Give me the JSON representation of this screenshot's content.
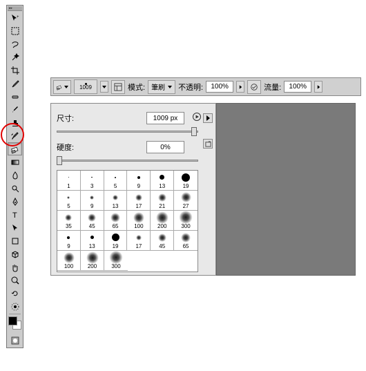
{
  "toolbox": {
    "tools": [
      "move-tool",
      "marquee-tool",
      "lasso-tool",
      "magic-wand-tool",
      "crop-tool",
      "eyedropper-tool",
      "healing-tool",
      "brush-tool",
      "stamp-tool",
      "history-brush-tool",
      "eraser-tool",
      "gradient-tool",
      "blur-tool",
      "dodge-tool",
      "pen-tool",
      "type-tool",
      "path-select-tool",
      "shape-tool",
      "3d-tool",
      "hand-tool",
      "zoom-tool",
      "rotate-tool",
      "artboard-tool"
    ],
    "selected": "eraser-tool"
  },
  "options": {
    "brush_size_display": "1009",
    "mode_label": "模式:",
    "mode_value": "筆刷",
    "opacity_label": "不透明:",
    "opacity_value": "100%",
    "flow_label": "流量:",
    "flow_value": "100%"
  },
  "brush_panel": {
    "size_label": "尺寸:",
    "size_value": "1009 px",
    "hardness_label": "硬度:",
    "hardness_value": "0%",
    "size_slider_pos": 100,
    "hardness_slider_pos": 0,
    "grid": [
      [
        {
          "s": 1,
          "d": 1,
          "soft": false
        },
        {
          "s": 3,
          "d": 1.5,
          "soft": false
        },
        {
          "s": 5,
          "d": 2,
          "soft": false
        },
        {
          "s": 9,
          "d": 4,
          "soft": false
        },
        {
          "s": 13,
          "d": 7,
          "soft": false
        },
        {
          "s": 19,
          "d": 12,
          "soft": false
        }
      ],
      [
        {
          "s": 5,
          "d": 4,
          "soft": true
        },
        {
          "s": 9,
          "d": 6,
          "soft": true
        },
        {
          "s": 13,
          "d": 8,
          "soft": true
        },
        {
          "s": 17,
          "d": 10,
          "soft": true
        },
        {
          "s": 21,
          "d": 12,
          "soft": true
        },
        {
          "s": 27,
          "d": 15,
          "soft": true
        }
      ],
      [
        {
          "s": 35,
          "d": 10,
          "soft": true
        },
        {
          "s": 45,
          "d": 12,
          "soft": true
        },
        {
          "s": 65,
          "d": 14,
          "soft": true
        },
        {
          "s": 100,
          "d": 16,
          "soft": true
        },
        {
          "s": 200,
          "d": 18,
          "soft": true
        },
        {
          "s": 300,
          "d": 20,
          "soft": true
        }
      ],
      [
        {
          "s": 9,
          "d": 4,
          "soft": false
        },
        {
          "s": 13,
          "d": 5,
          "soft": false
        },
        {
          "s": 19,
          "d": 11,
          "soft": false
        },
        {
          "s": 17,
          "d": 8,
          "soft": true
        },
        {
          "s": 45,
          "d": 12,
          "soft": true
        },
        {
          "s": 65,
          "d": 14,
          "soft": true
        }
      ],
      [
        {
          "s": 100,
          "d": 16,
          "soft": true
        },
        {
          "s": 200,
          "d": 18,
          "soft": true
        },
        {
          "s": 300,
          "d": 20,
          "soft": true
        }
      ]
    ]
  }
}
